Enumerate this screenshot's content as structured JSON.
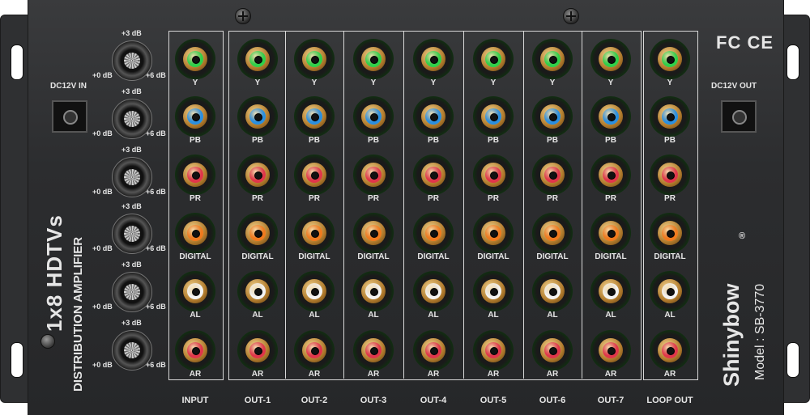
{
  "device": {
    "brand": "Shinybow",
    "registered_mark": "®",
    "model": "Model : SB-3770",
    "product_line1": "1x8 HDTVs",
    "product_line2": "DISTRIBUTION AMPLIFIER",
    "dc_in_label": "DC12V IN",
    "dc_out_label": "DC12V OUT",
    "cert_marks": "FC CE"
  },
  "knob_scale": {
    "top": "+3 dB",
    "left": "+0 dB",
    "right": "+6 dB"
  },
  "knob_count": 6,
  "connector_rows": [
    {
      "label": "Y",
      "color": "#2fd04a"
    },
    {
      "label": "PB",
      "color": "#2a8fe0"
    },
    {
      "label": "PR",
      "color": "#e0364a"
    },
    {
      "label": "DIGITAL",
      "color": "#f07a1e"
    },
    {
      "label": "AL",
      "color": "#f4f4f4"
    },
    {
      "label": "AR",
      "color": "#e0364a"
    }
  ],
  "columns": [
    "INPUT",
    "OUT-1",
    "OUT-2",
    "OUT-3",
    "OUT-4",
    "OUT-5",
    "OUT-6",
    "OUT-7",
    "LOOP OUT"
  ],
  "colors": {
    "panel": "#2c2d2f",
    "text": "#e6e6e6",
    "box": "#d8d8d8"
  }
}
